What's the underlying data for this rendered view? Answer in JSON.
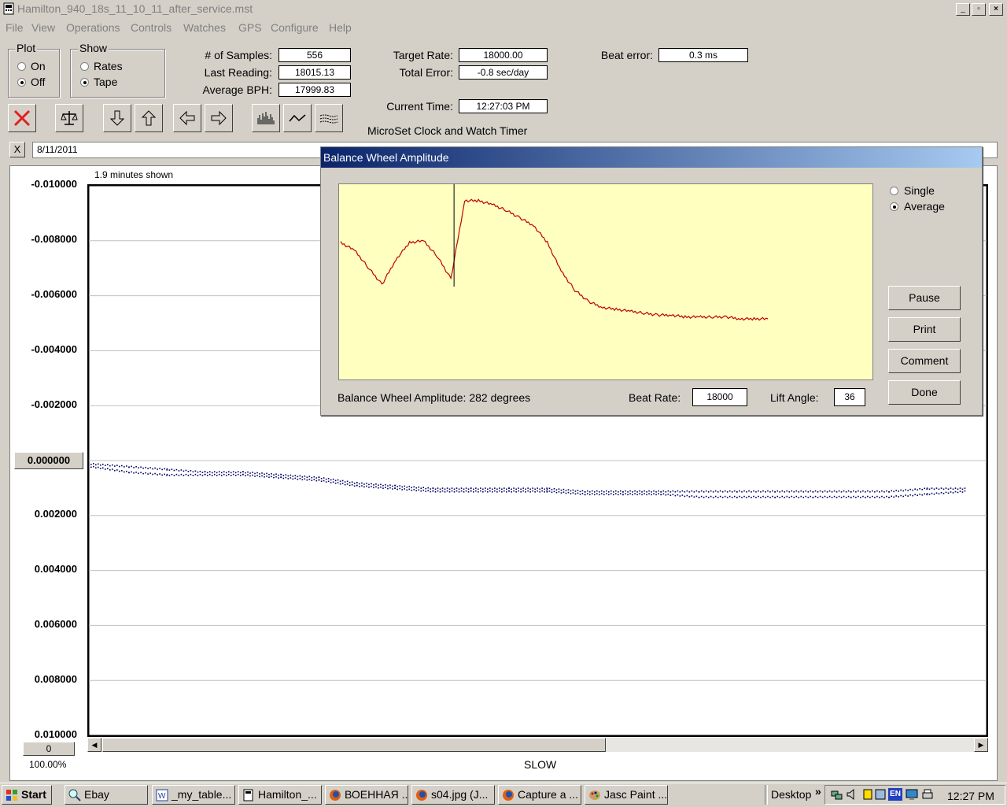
{
  "window": {
    "title": "Hamilton_940_18s_11_10_11_after_service.mst"
  },
  "menu": [
    "File",
    "View",
    "Operations",
    "Controls",
    "Watches",
    "GPS",
    "Configure",
    "Help"
  ],
  "plot_group": {
    "title": "Plot",
    "options": [
      "On",
      "Off"
    ],
    "selected": "Off"
  },
  "show_group": {
    "title": "Show",
    "options": [
      "Rates",
      "Tape"
    ],
    "selected": "Tape"
  },
  "stats": {
    "samples_label": "# of Samples:",
    "samples": "556",
    "last_reading_label": "Last Reading:",
    "last_reading": "18015.13",
    "avg_bph_label": "Average BPH:",
    "avg_bph": "17999.83",
    "target_rate_label": "Target Rate:",
    "target_rate": "18000.00",
    "total_error_label": "Total Error:",
    "total_error": "-0.8 sec/day",
    "current_time_label": "Current Time:",
    "current_time": "12:27:03 PM",
    "beat_error_label": "Beat error:",
    "beat_error": "0.3 ms"
  },
  "app_caption": "MicroSet Clock and Watch Timer",
  "comment_bar": {
    "close_label": "X",
    "text": "8/11/2011"
  },
  "chart": {
    "shown_label": "1.9 minutes shown",
    "y_labels": [
      "-0.010000",
      "-0.008000",
      "-0.006000",
      "-0.004000",
      "-0.002000",
      "0.000000",
      "0.002000",
      "0.004000",
      "0.006000",
      "0.008000",
      "0.010000"
    ],
    "bottom_value": "0",
    "zoom": "100.00%",
    "x_caption": "SLOW"
  },
  "chart_data": {
    "type": "scatter",
    "title": "",
    "ylim": [
      -0.01,
      0.01
    ],
    "y_inverted": true,
    "grid": true,
    "series": [
      {
        "values": [
          0.0001,
          0.0002,
          0.0003,
          0.0004,
          0.0004,
          0.0005,
          0.0006,
          0.0008,
          0.0009,
          0.001,
          0.001,
          0.001,
          0.001,
          0.0011,
          0.0011,
          0.0011,
          0.0011,
          0.0011,
          0.0011,
          0.0011,
          0.0011,
          0.0011,
          0.001,
          0.001
        ]
      },
      {
        "values": [
          0.0002,
          0.0004,
          0.0005,
          0.0005,
          0.0005,
          0.0006,
          0.0007,
          0.0009,
          0.001,
          0.0011,
          0.0011,
          0.0011,
          0.0011,
          0.0012,
          0.0012,
          0.0012,
          0.0013,
          0.0013,
          0.0013,
          0.0013,
          0.0013,
          0.0013,
          0.0012,
          0.0011
        ]
      }
    ]
  },
  "dialog": {
    "title": "Balance Wheel Amplitude",
    "mode_options": [
      "Single",
      "Average"
    ],
    "mode_selected": "Average",
    "buttons": [
      "Pause",
      "Print",
      "Comment",
      "Done"
    ],
    "amplitude_text": "Balance Wheel Amplitude: 282 degrees",
    "beat_rate_label": "Beat Rate:",
    "beat_rate": "18000",
    "lift_angle_label": "Lift Angle:",
    "lift_angle": "36",
    "chart_data": {
      "type": "line",
      "color": "#c00000",
      "values": [
        0.71,
        0.67,
        0.58,
        0.49,
        0.62,
        0.71,
        0.72,
        0.64,
        0.52,
        0.93,
        0.93,
        0.91,
        0.88,
        0.84,
        0.8,
        0.71,
        0.56,
        0.46,
        0.4,
        0.37,
        0.36,
        0.35,
        0.34,
        0.33,
        0.33,
        0.32,
        0.32,
        0.32,
        0.32,
        0.31,
        0.31,
        0.31
      ]
    }
  },
  "taskbar": {
    "start": "Start",
    "items": [
      "Ebay",
      "_my_table...",
      "Hamilton_...",
      "ВОЕННАЯ ...",
      "s04.jpg (J...",
      "Capture a ...",
      "Jasc Paint ..."
    ],
    "desktop": "Desktop",
    "lang": "EN",
    "clock": "12:27 PM"
  },
  "colors": {
    "dialog_plot_bg": "#ffffc0",
    "tape_dots": "#000060",
    "dialog_gradient_start": "#0a246a"
  }
}
